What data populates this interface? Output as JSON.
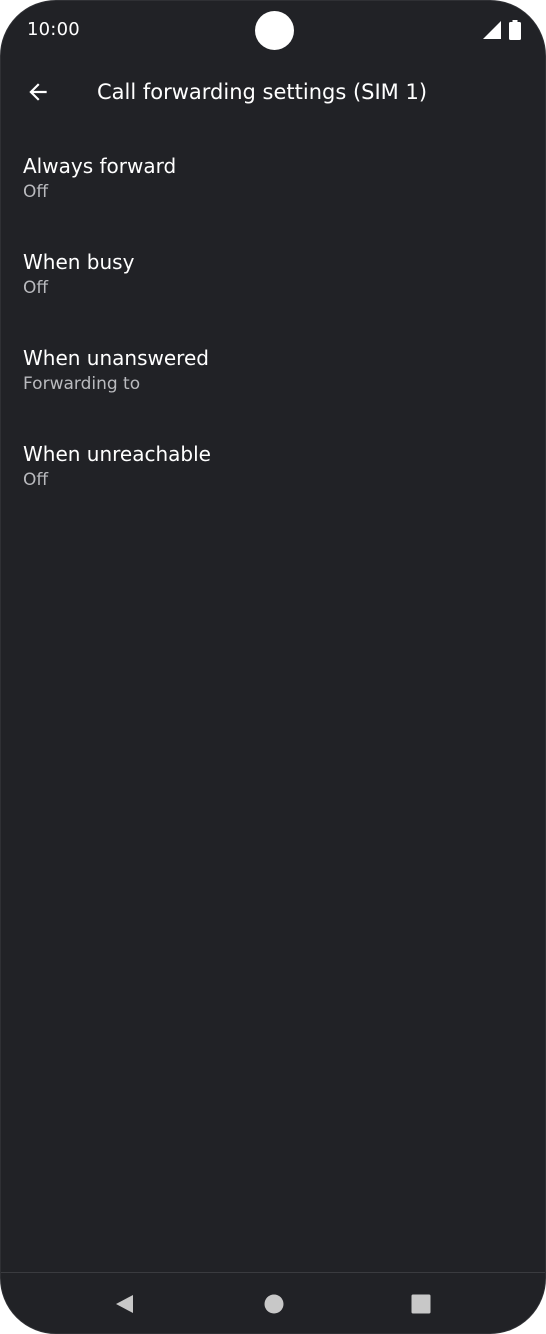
{
  "status_bar": {
    "time": "10:00",
    "icons": [
      "signal-icon",
      "battery-icon"
    ]
  },
  "app_bar": {
    "back_icon": "arrow-back-icon",
    "title": "Call forwarding settings (SIM 1)"
  },
  "settings": {
    "items": [
      {
        "title": "Always forward",
        "summary": "Off"
      },
      {
        "title": "When busy",
        "summary": "Off"
      },
      {
        "title": "When unanswered",
        "summary": "Forwarding to"
      },
      {
        "title": "When unreachable",
        "summary": "Off"
      }
    ]
  },
  "nav_bar": {
    "icons": [
      "nav-back-icon",
      "nav-home-icon",
      "nav-recents-icon"
    ]
  },
  "colors": {
    "background": "#212226",
    "text_primary": "#ffffff",
    "text_secondary": "#b9babe",
    "nav_icon": "#c8c8c8"
  }
}
